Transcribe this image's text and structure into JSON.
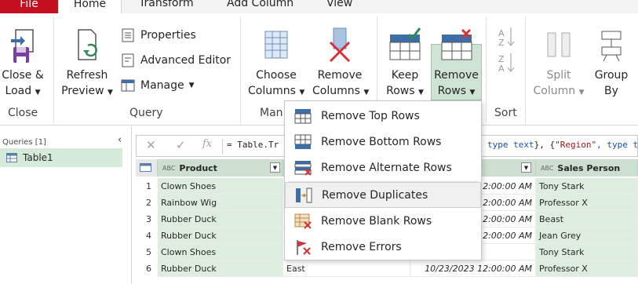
{
  "tabs": {
    "file": "File",
    "home": "Home",
    "transform": "Transform",
    "add_column": "Add Column",
    "view": "View"
  },
  "ribbon": {
    "close_load": [
      "Close &",
      "Load"
    ],
    "refresh_preview": [
      "Refresh",
      "Preview"
    ],
    "properties": "Properties",
    "advanced_editor": "Advanced Editor",
    "manage": "Manage",
    "choose_columns": [
      "Choose",
      "Columns"
    ],
    "remove_columns": [
      "Remove",
      "Columns"
    ],
    "keep_rows": [
      "Keep",
      "Rows"
    ],
    "remove_rows": [
      "Remove",
      "Rows"
    ],
    "split_column": [
      "Split",
      "Column"
    ],
    "group_by": [
      "Group",
      "By"
    ],
    "groups": {
      "close": "Close",
      "query": "Query",
      "manage": "Man",
      "sort": "Sort"
    }
  },
  "queries": {
    "header": "Queries [1]",
    "items": [
      "Table1"
    ]
  },
  "formula": {
    "text_start": "= Table.Tr",
    "text_end_type1": "type text",
    "text_end_sep": "}, {",
    "text_end_region": "\"Region\"",
    "text_end_type2": ", type te",
    "fx": "fx"
  },
  "grid": {
    "columns": [
      {
        "name": "Product",
        "type": "ABC"
      },
      {
        "name": "Sales Person",
        "type": "ABC"
      }
    ],
    "rows": [
      {
        "n": "1",
        "product": "Clown Shoes",
        "region": "",
        "date": "12:00:00 AM",
        "person": "Tony Stark"
      },
      {
        "n": "2",
        "product": "Rainbow Wig",
        "region": "",
        "date": "12:00:00 AM",
        "person": "Professor X"
      },
      {
        "n": "3",
        "product": "Rubber Duck",
        "region": "",
        "date": "12:00:00 AM",
        "person": "Beast"
      },
      {
        "n": "4",
        "product": "Rubber Duck",
        "region": "",
        "date": "12:00:00 AM",
        "person": "Jean Grey"
      },
      {
        "n": "5",
        "product": "Clown Shoes",
        "region": "",
        "date": "",
        "person": "Tony Stark"
      },
      {
        "n": "6",
        "product": "Rubber Duck",
        "region": "East",
        "date": "10/23/2023 12:00:00 AM",
        "person": "Professor X"
      }
    ]
  },
  "menu": {
    "items": [
      {
        "label": "Remove Top Rows",
        "icon": "remove-top-rows-icon"
      },
      {
        "label": "Remove Bottom Rows",
        "icon": "remove-bottom-rows-icon"
      },
      {
        "label": "Remove Alternate Rows",
        "icon": "remove-alternate-rows-icon"
      },
      {
        "label": "Remove Duplicates",
        "icon": "remove-duplicates-icon"
      },
      {
        "label": "Remove Blank Rows",
        "icon": "remove-blank-rows-icon"
      },
      {
        "label": "Remove Errors",
        "icon": "remove-errors-icon"
      }
    ]
  },
  "colors": {
    "accent_green": "#cfe3d5",
    "file_red": "#c50f1f",
    "icon_blue": "#3c6fa8",
    "icon_red": "#d13438"
  }
}
